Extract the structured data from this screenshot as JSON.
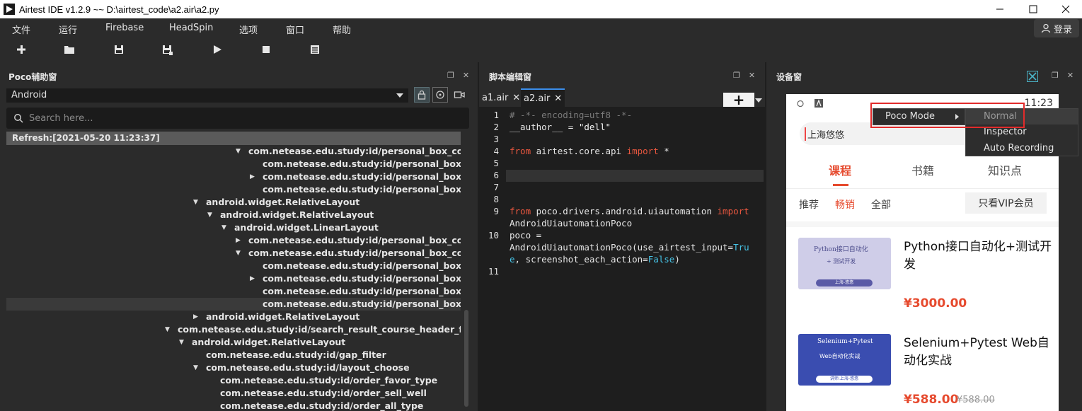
{
  "window": {
    "title": "Airtest IDE v1.2.9 ~~ D:\\airtest_code\\a2.air\\a2.py"
  },
  "menubar": {
    "items": [
      "文件",
      "运行",
      "Firebase",
      "HeadSpin",
      "选项",
      "窗口",
      "帮助"
    ],
    "login_label": "登录"
  },
  "toolbar": {
    "icons": [
      "new-icon",
      "open-icon",
      "save-icon",
      "save-as-icon",
      "run-icon",
      "stop-icon",
      "log-icon"
    ]
  },
  "poco_panel": {
    "title": "Poco辅助窗",
    "mode_select": "Android",
    "search_placeholder": "Search here...",
    "refresh_label": "Refresh:[2021-05-20 11:23:37]",
    "tree": [
      {
        "indent": 5,
        "arrow": "down",
        "label": "com.netease.edu.study:id/personal_box_co..."
      },
      {
        "indent": 6,
        "arrow": "",
        "label": "com.netease.edu.study:id/personal_box..."
      },
      {
        "indent": 6,
        "arrow": "right",
        "label": "com.netease.edu.study:id/personal_box..."
      },
      {
        "indent": 6,
        "arrow": "",
        "label": "com.netease.edu.study:id/personal_box..."
      },
      {
        "indent": 2,
        "arrow": "down",
        "label": "android.widget.RelativeLayout"
      },
      {
        "indent": 3,
        "arrow": "down",
        "label": "android.widget.RelativeLayout"
      },
      {
        "indent": 4,
        "arrow": "down",
        "label": "android.widget.LinearLayout"
      },
      {
        "indent": 5,
        "arrow": "right",
        "label": "com.netease.edu.study:id/personal_box_co..."
      },
      {
        "indent": 5,
        "arrow": "down",
        "label": "com.netease.edu.study:id/personal_box_co..."
      },
      {
        "indent": 6,
        "arrow": "",
        "label": "com.netease.edu.study:id/personal_box..."
      },
      {
        "indent": 6,
        "arrow": "right",
        "label": "com.netease.edu.study:id/personal_box..."
      },
      {
        "indent": 6,
        "arrow": "",
        "label": "com.netease.edu.study:id/personal_box..."
      },
      {
        "indent": 6,
        "arrow": "",
        "label": "com.netease.edu.study:id/personal_box...",
        "selected": true
      },
      {
        "indent": 2,
        "arrow": "right",
        "label": "android.widget.RelativeLayout"
      },
      {
        "indent": 0,
        "arrow": "down",
        "label": "com.netease.edu.study:id/search_result_course_header_filter"
      },
      {
        "indent": 1,
        "arrow": "down",
        "label": "android.widget.RelativeLayout"
      },
      {
        "indent": 2,
        "arrow": "",
        "label": "com.netease.edu.study:id/gap_filter"
      },
      {
        "indent": 2,
        "arrow": "down",
        "label": "com.netease.edu.study:id/layout_choose"
      },
      {
        "indent": 3,
        "arrow": "",
        "label": "com.netease.edu.study:id/order_favor_type"
      },
      {
        "indent": 3,
        "arrow": "",
        "label": "com.netease.edu.study:id/order_sell_well"
      },
      {
        "indent": 3,
        "arrow": "",
        "label": "com.netease.edu.study:id/order_all_type"
      }
    ]
  },
  "editor": {
    "title": "脚本编辑窗",
    "tabs": [
      {
        "label": "a1.air",
        "active": false
      },
      {
        "label": "a2.air",
        "active": true
      }
    ],
    "add_label": "+",
    "line_numbers": [
      "1",
      "2",
      "3",
      "4",
      "5",
      "6",
      "7",
      "8",
      "9",
      "10",
      "11"
    ],
    "code": {
      "l1": "# -*- encoding=utf8 -*-",
      "l2a": "__author__ = ",
      "l2b": "\"dell\"",
      "l4a": "from",
      "l4b": " airtest.core.api ",
      "l4c": "import",
      "l4d": " *",
      "l9a": "from",
      "l9b": " poco.drivers.android.uiautomation ",
      "l9c": "import",
      "l9d": "AndroidUiautomationPoco",
      "l10a": "poco =",
      "l10b": "AndroidUiautomationPoco(use_airtest_input=",
      "l10c": "Tru",
      "l10d": "e",
      "l10e": ", screenshot_each_action=",
      "l10f": "False",
      "l10g": ")"
    }
  },
  "device_panel": {
    "title": "设备窗",
    "phone": {
      "time": "11:23",
      "search_text": "上海悠悠",
      "tabs": [
        "课程",
        "书籍",
        "知识点"
      ],
      "subtabs": [
        "推荐",
        "畅销",
        "全部"
      ],
      "vip_button": "只看VIP会员",
      "courses": [
        {
          "title": "Python接口自动化+测试开发",
          "price": "¥3000.00",
          "old_price": "",
          "thumb_title": "Python接口自动化",
          "thumb_sub": "+ 测试开发",
          "thumb_tag": "上海-悠悠"
        },
        {
          "title": "Selenium+Pytest Web自动化实战",
          "price": "¥588.00",
          "old_price": "¥588.00",
          "thumb_title": "Selenium+Pytest",
          "thumb_sub": "Web自动化实战",
          "thumb_tag": "讲师:上海-悠悠"
        }
      ]
    }
  },
  "popup_menu": {
    "parent_label": "Poco Mode",
    "items": [
      "Normal",
      "Inspector",
      "Auto Recording"
    ]
  },
  "colors": {
    "accent_red": "#e64a2e",
    "highlight_box": "#e22b2b",
    "keyword": "#e9573f",
    "module": "#46c3e6"
  }
}
